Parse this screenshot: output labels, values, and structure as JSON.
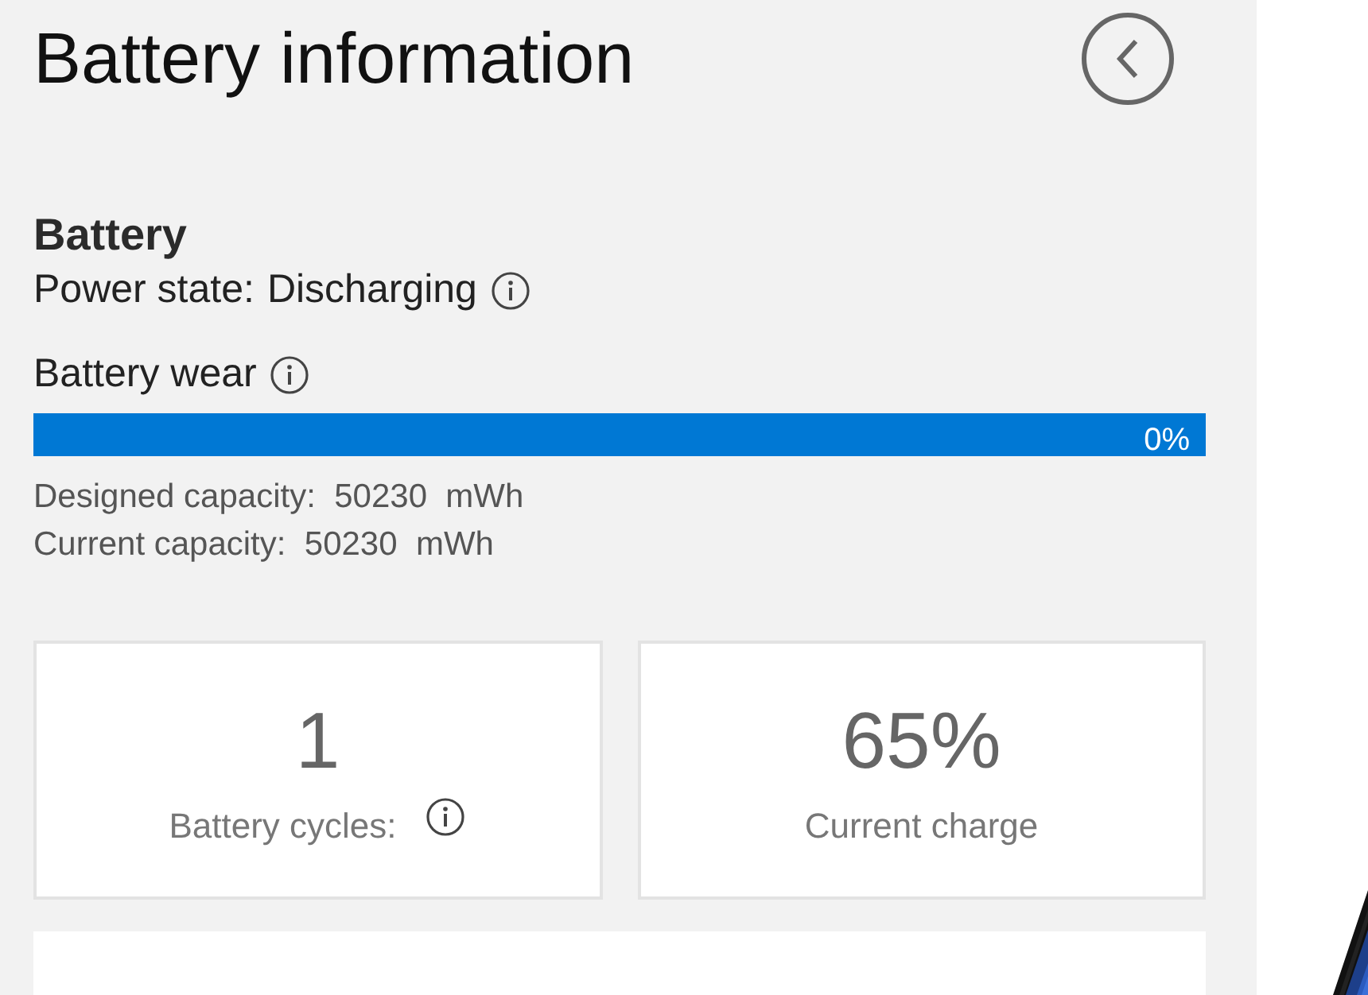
{
  "title": "Battery information",
  "section": {
    "heading": "Battery",
    "power_state_label": "Power state:",
    "power_state_value": "Discharging"
  },
  "wear": {
    "label": "Battery wear",
    "level": 1,
    "reading": "0%"
  },
  "capacities": [
    "Designed capacity:  50230  mWh",
    "Current capacity:  50230  mWh"
  ],
  "cards": [
    {
      "value": "1",
      "label": "Battery cycles:",
      "info": true
    },
    {
      "value": "65%",
      "label": "Current charge",
      "info": false
    }
  ]
}
